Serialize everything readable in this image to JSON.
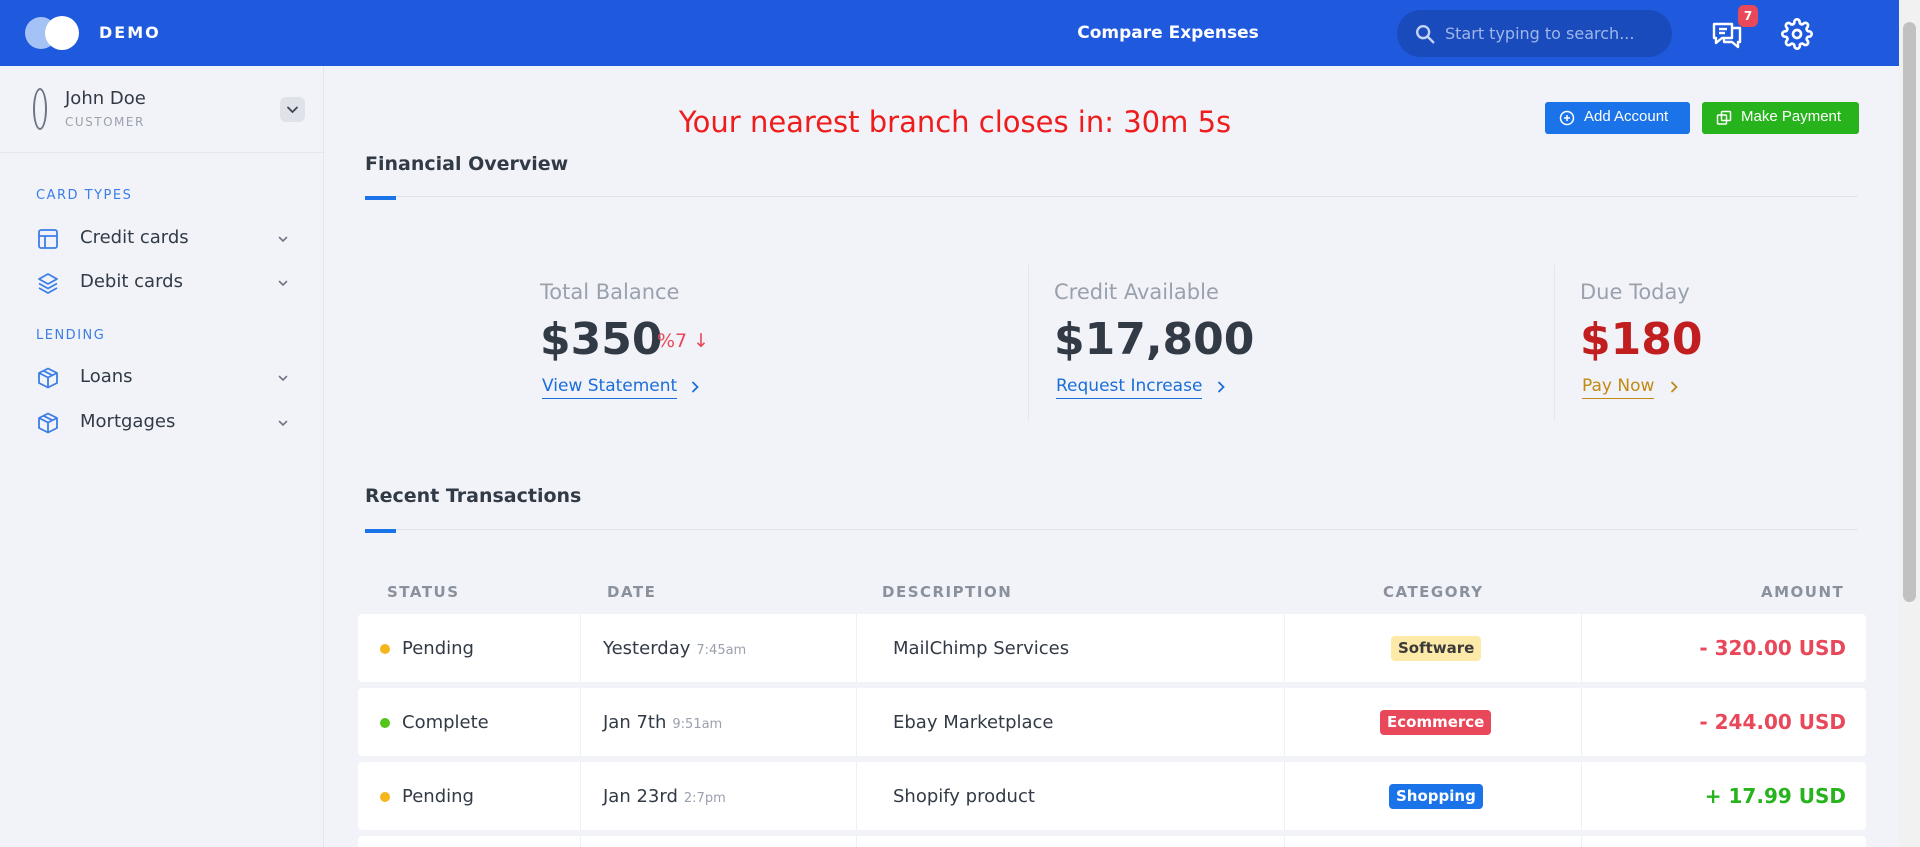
{
  "header": {
    "brand": "DEMO",
    "title": "Compare Expenses",
    "search_placeholder": "Start typing to search...",
    "notification_count": "7",
    "accent_color": "#1f5ade"
  },
  "user": {
    "name": "John Doe",
    "role": "CUSTOMER"
  },
  "sidebar": {
    "sections": [
      {
        "title": "CARD TYPES",
        "items": [
          {
            "label": "Credit cards",
            "icon": "layout-icon"
          },
          {
            "label": "Debit cards",
            "icon": "layers-icon"
          }
        ]
      },
      {
        "title": "LENDING",
        "items": [
          {
            "label": "Loans",
            "icon": "box-icon"
          },
          {
            "label": "Mortgages",
            "icon": "box-icon"
          }
        ]
      }
    ]
  },
  "countdown": "Your nearest branch closes in: 30m 5s",
  "actions": {
    "add_account": "Add Account",
    "make_payment": "Make Payment"
  },
  "overview": {
    "title": "Financial Overview",
    "stats": [
      {
        "label": "Total Balance",
        "value": "$350",
        "delta": "%7 ↓",
        "link": "View Statement",
        "value_color": "#323a46",
        "link_color": "#1a6ed8"
      },
      {
        "label": "Credit Available",
        "value": "$17,800",
        "link": "Request Increase",
        "value_color": "#323a46",
        "link_color": "#1a6ed8"
      },
      {
        "label": "Due Today",
        "value": "$180",
        "link": "Pay Now",
        "value_color": "#c11f1f",
        "link_color": "#c08a14"
      }
    ]
  },
  "transactions": {
    "title": "Recent Transactions",
    "columns": [
      "STATUS",
      "DATE",
      "DESCRIPTION",
      "CATEGORY",
      "AMOUNT"
    ],
    "rows": [
      {
        "status": "Pending",
        "status_color": "#f5b51d",
        "date": "Yesterday",
        "time": "7:45am",
        "description": "MailChimp Services",
        "category": "Software",
        "category_bg": "#fde9a8",
        "category_fg": "#3a3a3a",
        "amount": "- 320.00 USD",
        "amount_color": "#e8485a"
      },
      {
        "status": "Complete",
        "status_color": "#52c41a",
        "date": "Jan 7th",
        "time": "9:51am",
        "description": "Ebay Marketplace",
        "category": "Ecommerce",
        "category_bg": "#e8485a",
        "category_fg": "#ffffff",
        "amount": "- 244.00 USD",
        "amount_color": "#e8485a"
      },
      {
        "status": "Pending",
        "status_color": "#f5b51d",
        "date": "Jan 23rd",
        "time": "2:7pm",
        "description": "Shopify product",
        "category": "Shopping",
        "category_bg": "#1a73e8",
        "category_fg": "#ffffff",
        "amount": "+ 17.99 USD",
        "amount_color": "#27b31c"
      }
    ]
  }
}
